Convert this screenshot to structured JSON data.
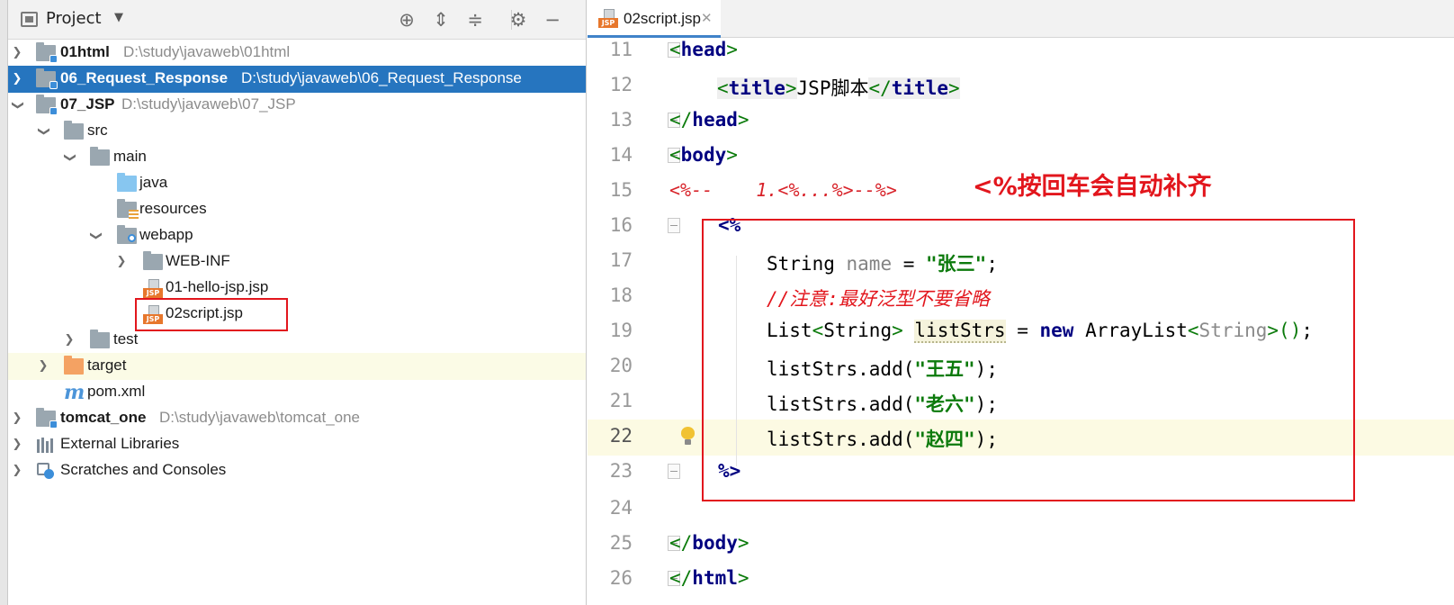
{
  "project_panel": {
    "title": "Project",
    "tree": [
      {
        "label": "01html",
        "path": "D:\\study\\javaweb\\01html"
      },
      {
        "label": "06_Request_Response",
        "path": "D:\\study\\javaweb\\06_Request_Response"
      },
      {
        "label": "07_JSP",
        "path": "D:\\study\\javaweb\\07_JSP"
      },
      {
        "label": "src"
      },
      {
        "label": "main"
      },
      {
        "label": "java"
      },
      {
        "label": "resources"
      },
      {
        "label": "webapp"
      },
      {
        "label": "WEB-INF"
      },
      {
        "label": "01-hello-jsp.jsp"
      },
      {
        "label": "02script.jsp"
      },
      {
        "label": "test"
      },
      {
        "label": "target"
      },
      {
        "label": "pom.xml"
      },
      {
        "label": "tomcat_one",
        "path": "D:\\study\\javaweb\\tomcat_one"
      },
      {
        "label": "External Libraries"
      },
      {
        "label": "Scratches and Consoles"
      }
    ]
  },
  "editor": {
    "tab_label": "02script.jsp",
    "file_icon_label": "JSP",
    "line_numbers": [
      "11",
      "12",
      "13",
      "14",
      "15",
      "16",
      "17",
      "18",
      "19",
      "20",
      "21",
      "22",
      "23",
      "24",
      "25",
      "26"
    ],
    "code": {
      "l11": "head",
      "l12_tag": "title",
      "l12_text": "JSP脚本",
      "l13": "head",
      "l14": "body",
      "l15_open": "<%--",
      "l15_text": "1.<%...%>--%>",
      "l16": "<%",
      "l17_type": "String",
      "l17_var": "name",
      "l17_eq": " = ",
      "l17_str": "\"张三\"",
      "l18": "//注意:最好泛型不要省略",
      "l19_type": "List",
      "l19_gen": "String",
      "l19_var": "listStrs",
      "l19_kw": "new",
      "l19_cls": "ArrayList",
      "l20_call": "listStrs.add(",
      "l20_str": "\"王五\"",
      "l21_str": "\"老六\"",
      "l22_str": "\"赵四\"",
      "l23": "%>",
      "l25": "body",
      "l26": "html"
    },
    "annotation": "<%按回车会自动补齐"
  },
  "colors": {
    "selection": "#2675bf",
    "annotation_red": "#e2161d",
    "tag_name": "#000080",
    "string": "#0c7a0c"
  }
}
